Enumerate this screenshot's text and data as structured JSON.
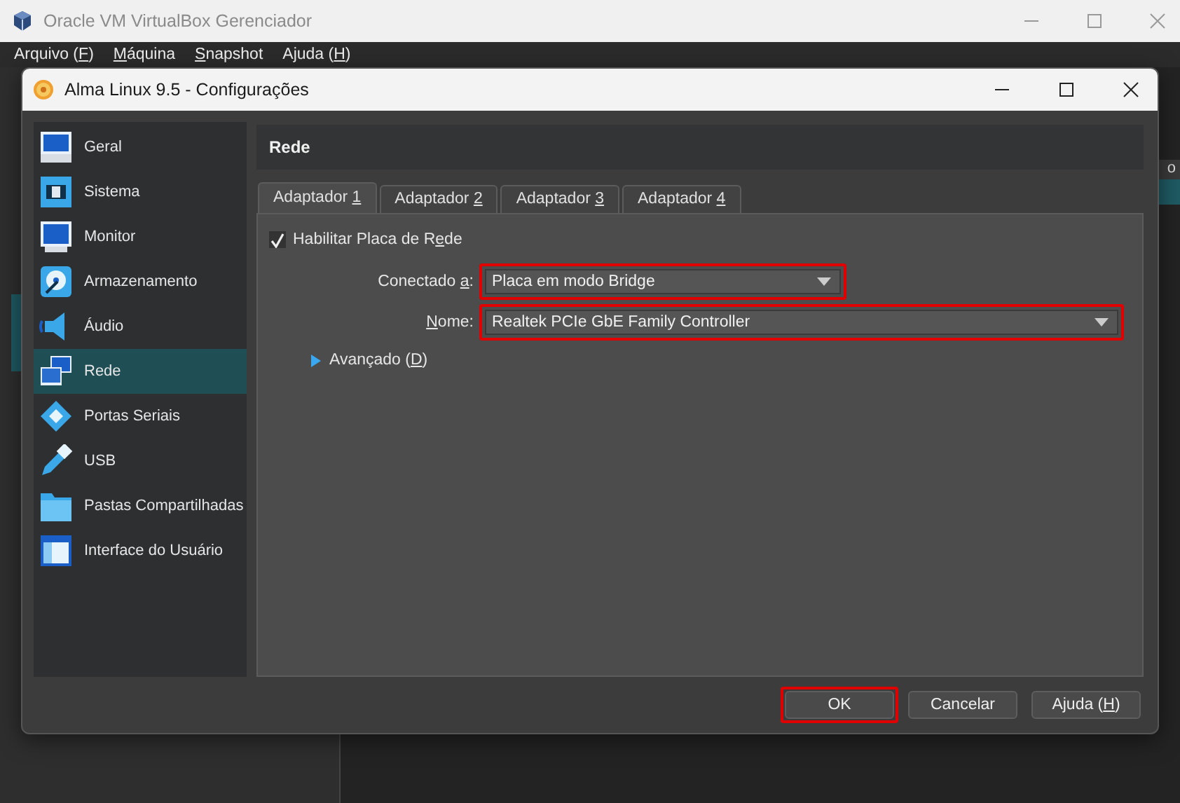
{
  "main_window": {
    "title": "Oracle VM VirtualBox Gerenciador",
    "menu": [
      {
        "pre": "Arquivo (",
        "key": "F",
        "post": ")"
      },
      {
        "key": "M",
        "post": "áquina"
      },
      {
        "key": "S",
        "post": "napshot"
      },
      {
        "pre": "Ajuda (",
        "key": "H",
        "post": ")"
      }
    ],
    "column_fragment": "o"
  },
  "dialog": {
    "title": "Alma Linux 9.5 - Configurações",
    "sidebar": {
      "items": [
        {
          "label": "Geral",
          "kind": "display",
          "selected": false
        },
        {
          "label": "Sistema",
          "kind": "chip",
          "selected": false
        },
        {
          "label": "Monitor",
          "kind": "monitor",
          "selected": false
        },
        {
          "label": "Armazenamento",
          "kind": "disk",
          "selected": false
        },
        {
          "label": "Áudio",
          "kind": "speaker",
          "selected": false
        },
        {
          "label": "Rede",
          "kind": "network",
          "selected": true
        },
        {
          "label": "Portas Seriais",
          "kind": "serial",
          "selected": false
        },
        {
          "label": "USB",
          "kind": "usb",
          "selected": false
        },
        {
          "label": "Pastas Compartilhadas",
          "kind": "folder",
          "selected": false
        },
        {
          "label": "Interface do Usuário",
          "kind": "window",
          "selected": false
        }
      ]
    },
    "section_title": "Rede",
    "tabs": [
      {
        "pre": "Adaptador ",
        "key": "1",
        "selected": true
      },
      {
        "pre": "Adaptador ",
        "key": "2",
        "selected": false
      },
      {
        "pre": "Adaptador ",
        "key": "3",
        "selected": false
      },
      {
        "pre": "Adaptador ",
        "key": "4",
        "selected": false
      }
    ],
    "enable_checkbox": {
      "pre": "Habilitar Placa de R",
      "key": "e",
      "post": "de",
      "checked": true
    },
    "fields": [
      {
        "label": {
          "pre": "Conectado ",
          "key": "a",
          "post": ":"
        },
        "value": "Placa em modo Bridge",
        "highlighted": true
      },
      {
        "label": {
          "key": "N",
          "post": "ome:"
        },
        "value": "Realtek PCIe GbE Family Controller",
        "highlighted": true
      }
    ],
    "advanced": {
      "pre": "Avançado (",
      "key": "D",
      "post": ")",
      "expanded": false
    },
    "buttons": [
      {
        "pre": "OK",
        "highlighted": true
      },
      {
        "pre": "Cancelar",
        "highlighted": false
      },
      {
        "pre": "Ajuda (",
        "key": "H",
        "post": ")",
        "highlighted": false
      }
    ]
  }
}
